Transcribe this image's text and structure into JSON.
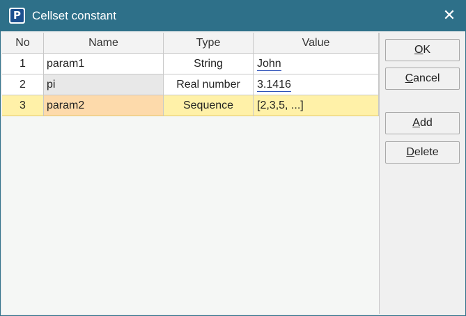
{
  "window": {
    "title": "Cellset constant",
    "app_icon": "P"
  },
  "table": {
    "headers": {
      "no": "No",
      "name": "Name",
      "type": "Type",
      "value": "Value"
    },
    "rows": [
      {
        "no": "1",
        "name": "param1",
        "type": "String",
        "value": "John"
      },
      {
        "no": "2",
        "name": "pi",
        "type": "Real number",
        "value": "3.1416"
      },
      {
        "no": "3",
        "name": "param2",
        "type": "Sequence",
        "value": "[2,3,5, ...]"
      }
    ]
  },
  "buttons": {
    "ok": {
      "mnemonic": "O",
      "rest": "K"
    },
    "cancel": {
      "mnemonic": "C",
      "rest": "ancel"
    },
    "add": {
      "mnemonic": "A",
      "rest": "dd"
    },
    "delete": {
      "mnemonic": "D",
      "rest": "elete"
    }
  },
  "colors": {
    "titlebar": "#2e7089",
    "selected_row": "#fff1a8",
    "selected_name_cell": "#fddaab",
    "link_underline": "#2a4fb8"
  }
}
